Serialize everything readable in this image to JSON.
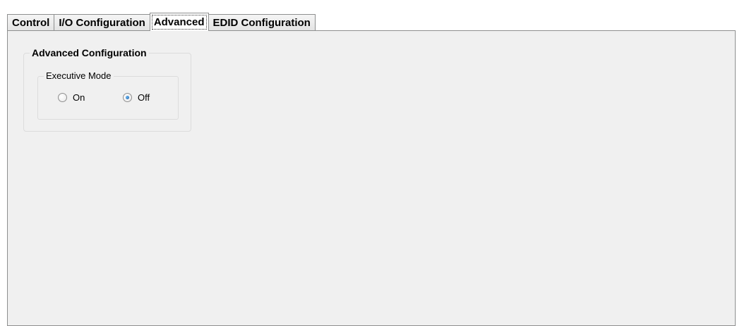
{
  "tabs": [
    {
      "label": "Control",
      "active": false
    },
    {
      "label": "I/O Configuration",
      "active": false
    },
    {
      "label": "Advanced",
      "active": true
    },
    {
      "label": "EDID Configuration",
      "active": false
    }
  ],
  "advanced": {
    "group_title": "Advanced Configuration",
    "executive_mode": {
      "title": "Executive Mode",
      "options": [
        {
          "label": "On",
          "checked": false
        },
        {
          "label": "Off",
          "checked": true
        }
      ]
    }
  },
  "colors": {
    "panel_background": "#f0f0f0",
    "border": "#8e8f8f",
    "radio_selected": "#1c5fa8"
  }
}
